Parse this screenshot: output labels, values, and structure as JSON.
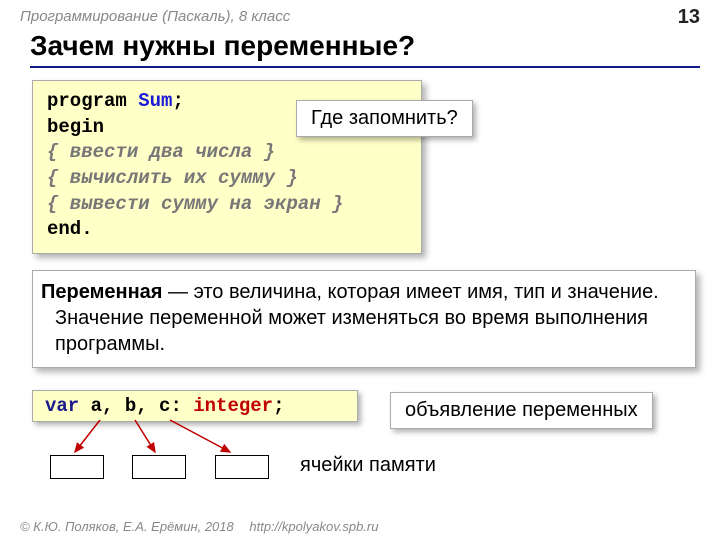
{
  "header": {
    "breadcrumb": "Программирование (Паскаль), 8 класс",
    "page": "13"
  },
  "title": "Зачем нужны переменные?",
  "code": {
    "l1a": "program ",
    "l1b": "Sum",
    "l1c": ";",
    "l2": "begin",
    "c1": " { ввести два числа }",
    "c2": " { вычислить их сумму }",
    "c3": " { вывести сумму на экран }",
    "l6": "end."
  },
  "callouts": {
    "where": "Где запомнить?",
    "decl": "объявление переменных"
  },
  "definition": {
    "term": "Переменная",
    "rest": " — это величина, которая имеет имя, тип и значение. Значение переменной может изменяться во время выполнения программы."
  },
  "vardecl": {
    "kw": "var ",
    "names": "a, b, c",
    "colon": ": ",
    "type": "integer",
    "semi": ";"
  },
  "cells_label": "ячейки памяти",
  "footer": {
    "authors": "© К.Ю. Поляков, Е.А. Ерёмин, 2018",
    "url": "http://kpolyakov.spb.ru"
  }
}
